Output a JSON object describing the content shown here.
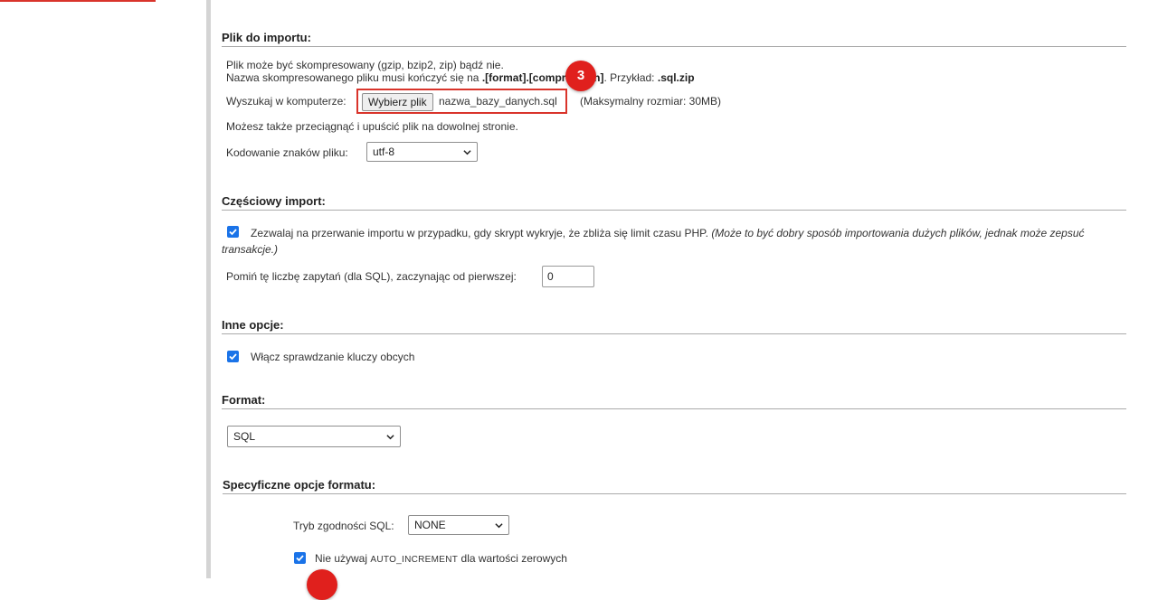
{
  "import_file": {
    "title": "Plik do importu:",
    "compress_line": "Plik może być skompresowany (gzip, bzip2, zip) bądź nie.",
    "name_line_prefix": "Nazwa skompresowanego pliku musi kończyć się na",
    "name_line_format": ".[format].[compression]",
    "name_line_example_label": ". Przykład:",
    "name_line_example": ".sql.zip",
    "browse_label": "Wyszukaj w komputerze:",
    "choose_button": "Wybierz plik",
    "file_name": "nazwa_bazy_danych.sql",
    "max_size": "(Maksymalny rozmiar: 30MB)",
    "drag_hint": "Możesz także przeciągnąć i upuścić plik na dowolnej stronie.",
    "encoding_label": "Kodowanie znaków pliku:",
    "encoding_value": "utf-8"
  },
  "step_badges": {
    "step3": "3"
  },
  "partial_import": {
    "title": "Częściowy import:",
    "interrupt_text": "Zezwalaj na przerwanie importu w przypadku, gdy skrypt wykryje, że zbliża się limit czasu PHP.",
    "interrupt_note_line1": "(Może to być dobry sposób importowania dużych plików, jednak może zepsuć",
    "interrupt_note_line2": "transakcje.)",
    "interrupt_checked": true,
    "skip_label": "Pomiń tę liczbę zapytań (dla SQL), zaczynając od pierwszej:",
    "skip_value": "0"
  },
  "other_options": {
    "title": "Inne opcje:",
    "foreign_keys_label": "Włącz sprawdzanie kluczy obcych",
    "foreign_keys_checked": true
  },
  "format": {
    "title": "Format:",
    "value": "SQL"
  },
  "format_specific": {
    "title": "Specyficzne opcje formatu:",
    "compat_label": "Tryb zgodności SQL:",
    "compat_value": "NONE",
    "auto_inc_prefix": "Nie używaj",
    "auto_inc_keyword": "AUTO_INCREMENT",
    "auto_inc_suffix": "dla wartości zerowych",
    "auto_inc_checked": true
  },
  "colors": {
    "highlight_red": "#d9342b",
    "badge_red": "#e0201d",
    "checkbox_blue": "#1a73e8"
  }
}
